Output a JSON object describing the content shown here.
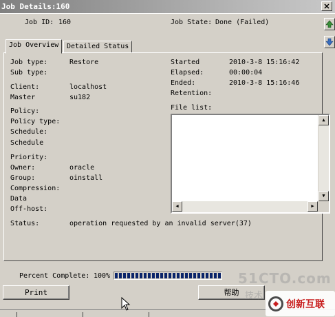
{
  "window": {
    "title": "Job Details:160"
  },
  "header": {
    "job_id_label": "Job ID:",
    "job_id": "160",
    "job_state_label": "Job State:",
    "job_state": "Done (Failed)"
  },
  "tabs": [
    {
      "label": "Job Overview",
      "active": true
    },
    {
      "label": "Detailed Status",
      "active": false
    }
  ],
  "overview": {
    "job_type_label": "Job type:",
    "job_type": "Restore",
    "sub_type_label": "Sub type:",
    "client_label": "Client:",
    "client": "localhost",
    "master_label": "Master",
    "master": "su182",
    "policy_label": "Policy:",
    "policy_type_label": "Policy type:",
    "schedule_label_1": "Schedule:",
    "schedule_label_2": "Schedule",
    "priority_label": "Priority:",
    "owner_label": "Owner:",
    "owner": "oracle",
    "group_label": "Group:",
    "group": "oinstall",
    "compression_label": "Compression:",
    "data_label": "Data",
    "offhost_label": "Off-host:",
    "started_label": "Started",
    "started": "2010-3-8 15:16:42",
    "elapsed_label": "Elapsed:",
    "elapsed": "00:00:04",
    "ended_label": "Ended:",
    "ended": "2010-3-8 15:16:46",
    "retention_label": "Retention:",
    "file_list_label": "File list:",
    "status_label": "Status:",
    "status": "operation requested by an invalid server(37)"
  },
  "progress": {
    "label": "Percent Complete:",
    "value_text": "100%",
    "fraction": 1.0,
    "bar_color": "#0a246a"
  },
  "buttons": {
    "print": "Print",
    "help": "帮助"
  },
  "watermark": {
    "site": "51CTO.com",
    "sub": "技术",
    "brand": "创新互联"
  },
  "icons": [
    "up-arrow-icon",
    "down-arrow-icon",
    "close-icon",
    "cursor-icon"
  ]
}
